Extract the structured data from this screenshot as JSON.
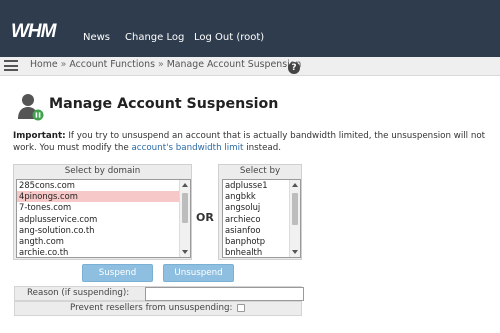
{
  "header": {
    "logo_text": "WHM",
    "nav": [
      "News",
      "Change Log",
      "Log Out (root)"
    ]
  },
  "breadcrumb": {
    "items": [
      "Home",
      "Account Functions",
      "Manage Account Suspension"
    ],
    "separator": "»",
    "help_glyph": "?"
  },
  "page": {
    "title": "Manage Account Suspension",
    "note_label": "Important:",
    "note_text_1": "If you try to unsuspend an account that is actually bandwidth limited, the unsuspension will not work. You must modify the",
    "note_link": "account's bandwidth limit",
    "note_text_2": "instead."
  },
  "domains": {
    "header": "Select by domain",
    "options": [
      "285cons.com",
      "4pinongs.com",
      "7-tones.com",
      "adplusservice.com",
      "ang-solution.co.th",
      "angth.com",
      "archie.co.th"
    ],
    "selected_index": 1
  },
  "or_label": "OR",
  "usernames": {
    "header": "Select by username",
    "options": [
      "adplusse1",
      "angbkk",
      "angsoluj",
      "archieco",
      "asianfoo",
      "banphotp",
      "bnhealth"
    ]
  },
  "buttons": {
    "suspend": "Suspend",
    "unsuspend": "Unsuspend"
  },
  "form": {
    "reason_label": "Reason (if suspending):",
    "reason_value": "",
    "prevent_label": "Prevent resellers from unsuspending:",
    "prevent_checked": false
  },
  "colors": {
    "header_bg": "#2e3c4d",
    "link": "#2a6aa6",
    "selected_option": "#f7c8c8",
    "button": "#8fbfe0"
  },
  "icons": {
    "menu": "hamburger-icon",
    "help": "help-icon",
    "page": "user-suspend-icon"
  }
}
